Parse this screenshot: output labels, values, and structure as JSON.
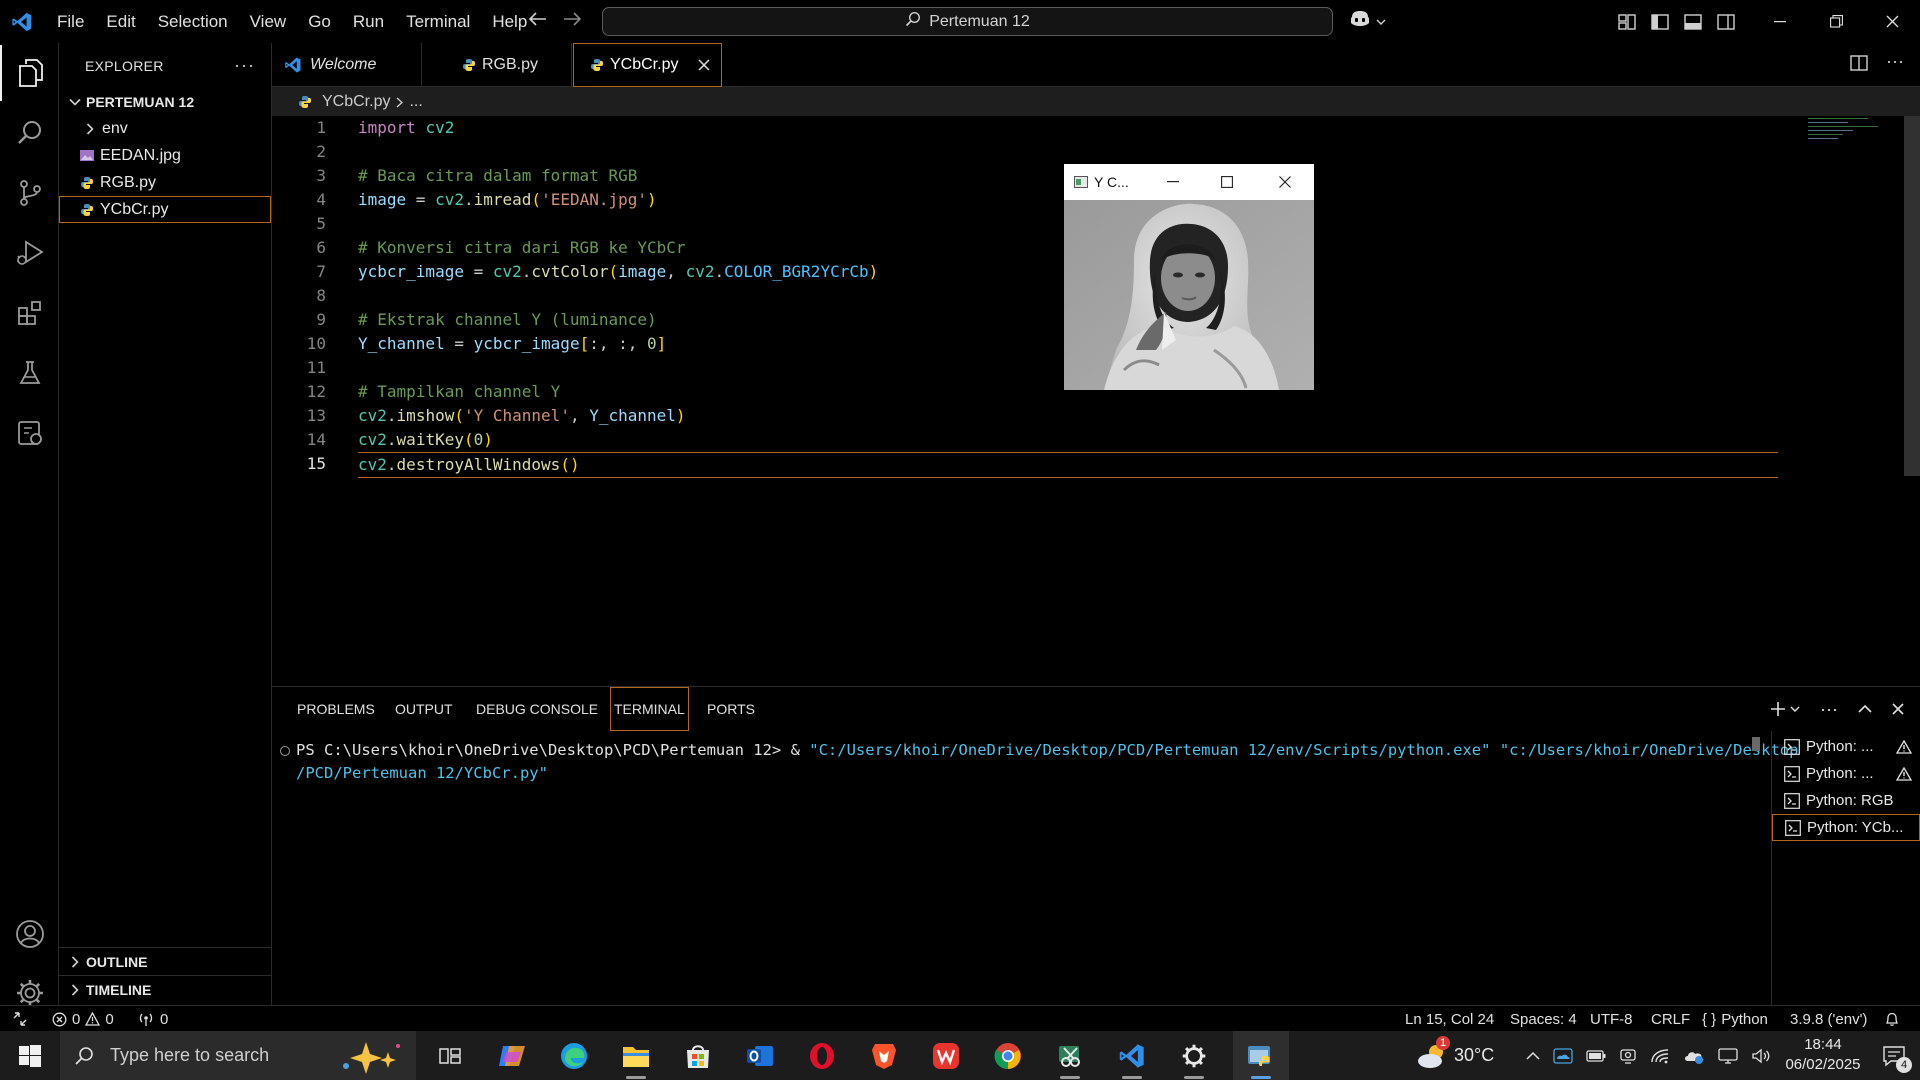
{
  "menu": [
    "File",
    "Edit",
    "Selection",
    "View",
    "Go",
    "Run",
    "Terminal",
    "Help"
  ],
  "search": {
    "label": "Pertemuan 12"
  },
  "explorer": {
    "title": "EXPLORER",
    "folder": "PERTEMUAN 12",
    "items": [
      {
        "name": "env",
        "kind": "folder"
      },
      {
        "name": "EEDAN.jpg",
        "kind": "image"
      },
      {
        "name": "RGB.py",
        "kind": "python"
      },
      {
        "name": "YCbCr.py",
        "kind": "python",
        "selected": true
      }
    ],
    "outline": "OUTLINE",
    "timeline": "TIMELINE"
  },
  "tabs": [
    {
      "label": "Welcome"
    },
    {
      "label": "RGB.py"
    },
    {
      "label": "YCbCr.py",
      "active": true
    }
  ],
  "breadcrumb": {
    "file": "YCbCr.py",
    "more": "..."
  },
  "editor": {
    "current_line": 15,
    "lines": [
      {
        "n": "1",
        "text": "import cv2"
      },
      {
        "n": "2",
        "text": ""
      },
      {
        "n": "3",
        "text": "# Baca citra dalam format RGB"
      },
      {
        "n": "4",
        "text": "image = cv2.imread('EEDAN.jpg')"
      },
      {
        "n": "5",
        "text": ""
      },
      {
        "n": "6",
        "text": "# Konversi citra dari RGB ke YCbCr"
      },
      {
        "n": "7",
        "text": "ycbcr_image = cv2.cvtColor(image, cv2.COLOR_BGR2YCrCb)"
      },
      {
        "n": "8",
        "text": ""
      },
      {
        "n": "9",
        "text": "# Ekstrak channel Y (luminance)"
      },
      {
        "n": "10",
        "text": "Y_channel = ycbcr_image[:, :, 0]"
      },
      {
        "n": "11",
        "text": ""
      },
      {
        "n": "12",
        "text": "# Tampilkan channel Y"
      },
      {
        "n": "13",
        "text": "cv2.imshow('Y Channel', Y_channel)"
      },
      {
        "n": "14",
        "text": "cv2.waitKey(0)"
      },
      {
        "n": "15",
        "text": "cv2.destroyAllWindows()"
      }
    ]
  },
  "image_window": {
    "title": "Y C..."
  },
  "panel": {
    "tabs": [
      "PROBLEMS",
      "OUTPUT",
      "DEBUG CONSOLE",
      "TERMINAL",
      "PORTS"
    ],
    "active_tab": "TERMINAL",
    "terminal": {
      "prompt": "PS C:\\Users\\khoir\\OneDrive\\Desktop\\PCD\\Pertemuan 12> & ",
      "exe": "\"C:/Users/khoir/OneDrive/Desktop/PCD/Pertemuan 12/env/Scripts/python.exe\"",
      "script_1": "\"c:/Users/khoir/OneDrive/Desktop",
      "script_2": "/PCD/Pertemuan 12/YCbCr.py\""
    },
    "terminals": [
      {
        "label": "Python: ...",
        "warning": true
      },
      {
        "label": "Python: ...",
        "warning": true
      },
      {
        "label": "Python: RGB",
        "warning": false
      },
      {
        "label": "Python: YCb...",
        "warning": false,
        "active": true
      }
    ]
  },
  "status": {
    "errors": "0",
    "warnings": "0",
    "ports": "0",
    "position": "Ln 15, Col 24",
    "spaces": "Spaces: 4",
    "encoding": "UTF-8",
    "eol": "CRLF",
    "language": "Python",
    "interpreter": "3.9.8 ('env')"
  },
  "taskbar": {
    "search_placeholder": "Type here to search",
    "weather": "30°C",
    "weather_badge": "1",
    "time": "18:44",
    "date": "06/02/2025",
    "notifications": "4"
  },
  "colors": {
    "accent_border": "#b5641a",
    "vscode_blue": "#2f8ee6",
    "editor_bg": "#000000"
  }
}
